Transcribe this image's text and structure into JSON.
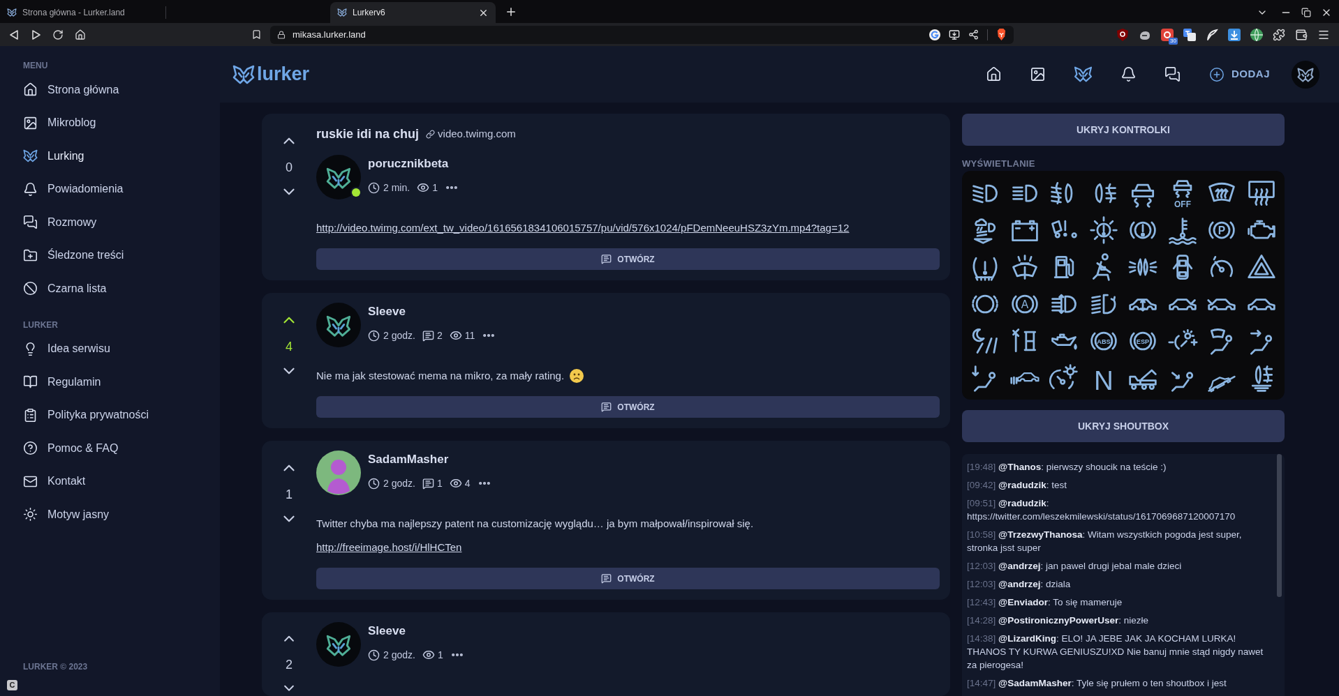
{
  "browser": {
    "tabs": [
      {
        "title": "Strona główna - Lurker.land",
        "selected": false
      },
      {
        "title": "Lurkerv6",
        "selected": true
      }
    ],
    "address": "mikasa.lurker.land",
    "extension_badge": "30"
  },
  "sidebar": {
    "sections": [
      {
        "heading": "MENU",
        "items": [
          {
            "label": "Strona główna",
            "kind": "home",
            "selected": false
          },
          {
            "label": "Mikroblog",
            "kind": "image",
            "selected": false
          },
          {
            "label": "Lurking",
            "kind": "logo",
            "selected": true
          },
          {
            "label": "Powiadomienia",
            "kind": "bell",
            "selected": false
          },
          {
            "label": "Rozmowy",
            "kind": "chat",
            "selected": false
          },
          {
            "label": "Śledzone treści",
            "kind": "folderplus",
            "selected": false
          },
          {
            "label": "Czarna lista",
            "kind": "ban",
            "selected": false
          }
        ]
      },
      {
        "heading": "LURKER",
        "items": [
          {
            "label": "Idea serwisu",
            "kind": "bulb",
            "selected": false
          },
          {
            "label": "Regulamin",
            "kind": "book",
            "selected": false
          },
          {
            "label": "Polityka prywatności",
            "kind": "clipboard",
            "selected": false
          },
          {
            "label": "Pomoc & FAQ",
            "kind": "help",
            "selected": false
          },
          {
            "label": "Kontakt",
            "kind": "mail",
            "selected": false
          },
          {
            "label": "Motyw jasny",
            "kind": "sun",
            "selected": false
          }
        ]
      }
    ],
    "footer": "LURKER © 2023"
  },
  "overlay_badge": "C",
  "header": {
    "logo": "lurker",
    "nav": [
      {
        "kind": "home",
        "selected": false
      },
      {
        "kind": "image",
        "selected": false
      },
      {
        "kind": "logo",
        "selected": true
      },
      {
        "kind": "bell",
        "selected": false
      },
      {
        "kind": "chat",
        "selected": false
      }
    ],
    "add_button": "DODAJ"
  },
  "posts": [
    {
      "upvoted": false,
      "score": "0",
      "title": "ruskie idi na chuj",
      "domain": "video.twimg.com",
      "avatar": {
        "kind": "logo"
      },
      "online": true,
      "author": "porucznikbeta",
      "time": "2 min.",
      "views": "1",
      "link": "http://video.twimg.com/ext_tw_video/1616561834106015757/pu/vid/576x1024/pFDemNeeuHSZ3zYm.mp4?tag=12",
      "button": "OTWÓRZ"
    },
    {
      "upvoted": true,
      "score": "4",
      "avatar": {
        "kind": "logo"
      },
      "online": false,
      "author": "Sleeve",
      "time": "2 godz.",
      "comments": "2",
      "views": "11",
      "body": "Nie ma jak stestować mema na mikro, za mały rating.",
      "emoji": {
        "kind": "frown"
      },
      "button": "OTWÓRZ"
    },
    {
      "upvoted": false,
      "score": "1",
      "avatar": {
        "kind": "silhouette"
      },
      "online": false,
      "author": "SadamMasher",
      "time": "2 godz.",
      "comments": "1",
      "views": "4",
      "body": "Twitter chyba ma najlepszy patent na customizację wyglądu… ja bym małpował/inspirował się.",
      "link": "http://freeimage.host/i/HlHCTen",
      "button": "OTWÓRZ"
    },
    {
      "upvoted": false,
      "score": "2",
      "avatar": {
        "kind": "logo"
      },
      "online": false,
      "author": "Sleeve",
      "time": "2 godz.",
      "views": "1"
    }
  ],
  "controls_button": "UKRYJ KONTROLKI",
  "display_heading": "WYŚWIETLANIE",
  "indicators": [
    {
      "kind": "lowbeam"
    },
    {
      "kind": "highbeam"
    },
    {
      "kind": "frontfog"
    },
    {
      "kind": "rearfog"
    },
    {
      "kind": "traction"
    },
    {
      "kind": "tractionoff",
      "text": "OFF"
    },
    {
      "kind": "frontdefrost"
    },
    {
      "kind": "reardefrost"
    },
    {
      "kind": "autolight"
    },
    {
      "kind": "battery"
    },
    {
      "kind": "partwarning"
    },
    {
      "kind": "lightfault"
    },
    {
      "kind": "brake"
    },
    {
      "kind": "coolant"
    },
    {
      "kind": "parking",
      "text": "P"
    },
    {
      "kind": "engine"
    },
    {
      "kind": "tirepressure"
    },
    {
      "kind": "washer"
    },
    {
      "kind": "fuel"
    },
    {
      "kind": "seatbelt"
    },
    {
      "kind": "sidelights"
    },
    {
      "kind": "doors"
    },
    {
      "kind": "cruise"
    },
    {
      "kind": "hazard"
    },
    {
      "kind": "brakewear"
    },
    {
      "kind": "autohold",
      "text": "A"
    },
    {
      "kind": "leveling"
    },
    {
      "kind": "adaptive"
    },
    {
      "kind": "suspension"
    },
    {
      "kind": "hood"
    },
    {
      "kind": "trunk"
    },
    {
      "kind": "car"
    },
    {
      "kind": "lanenight"
    },
    {
      "kind": "service"
    },
    {
      "kind": "oil"
    },
    {
      "kind": "abs",
      "text": "ABS"
    },
    {
      "kind": "esp",
      "text": "ESP"
    },
    {
      "kind": "dimmer"
    },
    {
      "kind": "airwindshield"
    },
    {
      "kind": "airface"
    },
    {
      "kind": "airfeet"
    },
    {
      "kind": "parksensor"
    },
    {
      "kind": "speedlight"
    },
    {
      "kind": "neutral",
      "text": "N"
    },
    {
      "kind": "truck"
    },
    {
      "kind": "airseat"
    },
    {
      "kind": "hill"
    },
    {
      "kind": "foglevel"
    }
  ],
  "shoutbox_button": "UKRYJ SHOUTBOX",
  "shoutbox": [
    {
      "time": "[19:48]",
      "message": "**@Thanos**: pierwszy shoucik na teście :)"
    },
    {
      "time": "[09:42]",
      "message": "**@radudzik**: test"
    },
    {
      "time": "[09:51]",
      "message": "**@radudzik**: https://twitter.com/leszekmilewski/status/1617069687120007170"
    },
    {
      "time": "[10:58]",
      "message": "**@TrzezwyThanosa**: Witam wszystkich pogoda jest super, stronka jsst super"
    },
    {
      "time": "[12:03]",
      "message": "**@andrzej**: jan pawel drugi jebal male dzieci"
    },
    {
      "time": "[12:03]",
      "message": "**@andrzej**: dziala"
    },
    {
      "time": "[12:43]",
      "message": "**@Enviador**: To się mameruje"
    },
    {
      "time": "[14:28]",
      "message": "**@PostironicznyPowerUser**: niezłe"
    },
    {
      "time": "[14:38]",
      "message": "**@LizardKing**: ELO! JA JEBE JAK JA KOCHAM LURKA! THANOS TY KURWA GENIUSZU!XD Nie banuj mnie stąd nigdy nawet za pierogesa!"
    },
    {
      "time": "[14:47]",
      "message": "**@SadamMasher**: Tyle się prułem o ten shoutbox i jest"
    }
  ]
}
